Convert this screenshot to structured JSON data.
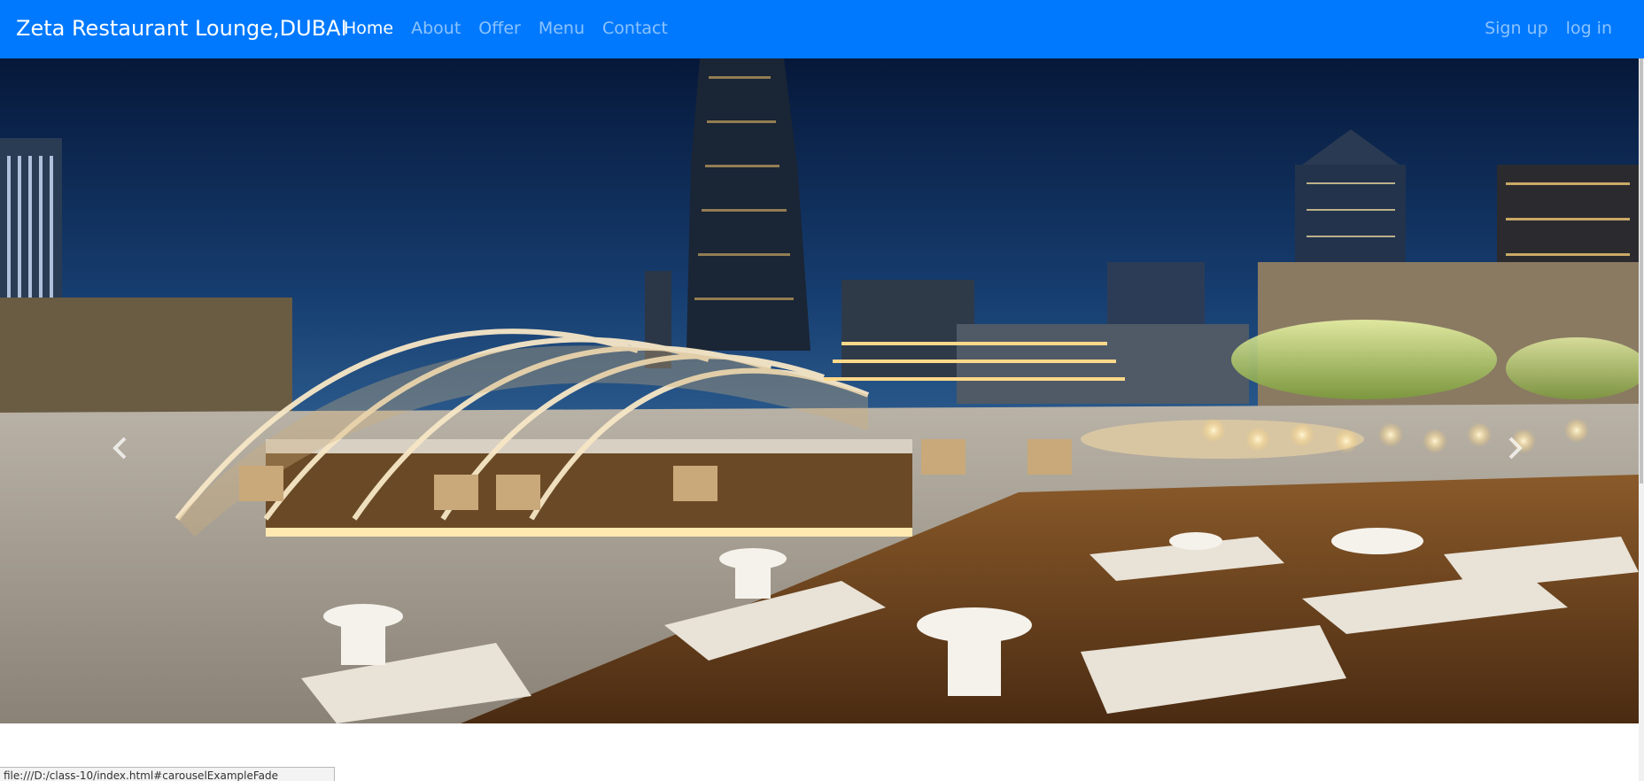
{
  "navbar": {
    "brand": "Zeta Restaurant Lounge,DUBAI",
    "links": [
      "Home",
      "About",
      "Offer",
      "Menu",
      "Contact"
    ],
    "active": "Home",
    "right_links": [
      "Sign up",
      "log in"
    ],
    "background_color": "#0079fe"
  },
  "carousel": {
    "image_description": "rooftop restaurant lounge at night with Burj Khalifa skyline",
    "prev_icon": "chevron-left-icon",
    "next_icon": "chevron-right-icon"
  },
  "status_bar": {
    "url": "file:///D:/class-10/index.html#carouselExampleFade"
  }
}
